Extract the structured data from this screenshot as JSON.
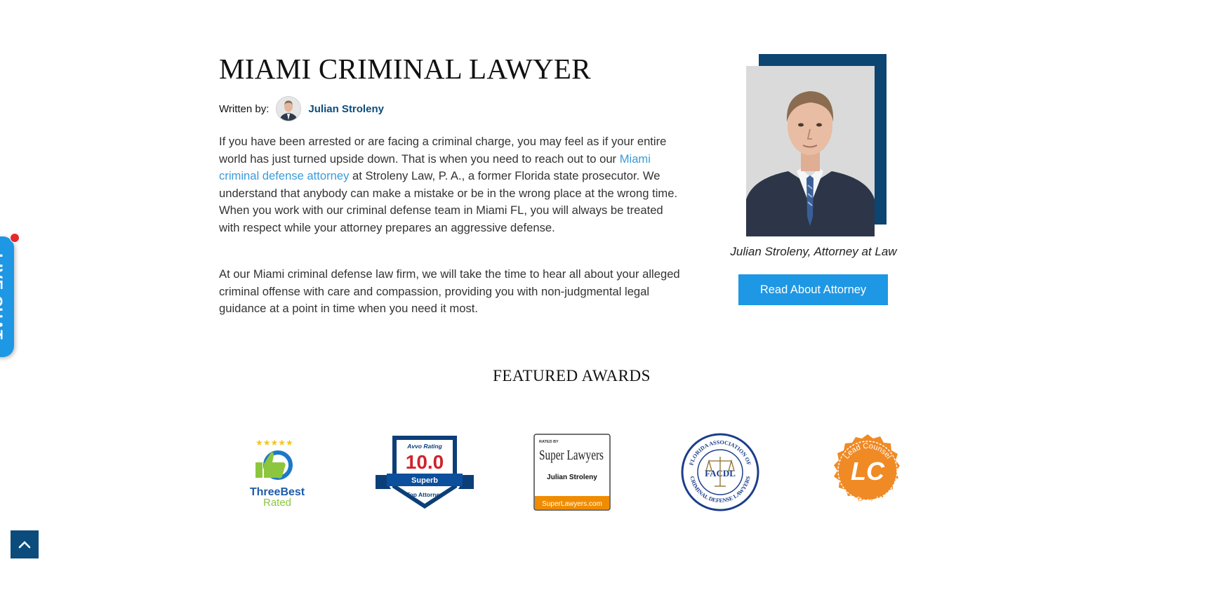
{
  "article": {
    "title": "MIAMI CRIMINAL LAWYER",
    "written_by_label": "Written by:",
    "author_name": "Julian Stroleny",
    "paragraph1_before_link": "If you have been arrested or are facing a criminal charge, you may feel as if your entire world has just turned upside down. That is when you need to reach out to our ",
    "paragraph1_link": "Miami criminal defense attorney",
    "paragraph1_after_link": " at Stroleny Law, P. A., a former Florida state prosecutor. We understand that anybody can make a mistake or be in the wrong place at the wrong time. When you work with our criminal defense team in Miami FL, you will always be treated with respect while your attorney prepares an aggressive defense.",
    "paragraph2": "At our Miami criminal defense law firm, we will take the time to hear all about your alleged criminal offense with care and compassion, providing you with non-judgmental legal guidance at a point in time when you need it most."
  },
  "attorney_card": {
    "caption": "Julian Stroleny, Attorney at Law",
    "button_label": "Read About Attorney"
  },
  "awards": {
    "title": "FEATURED AWARDS",
    "threebest": {
      "line1": "ThreeBest",
      "line2": "Rated"
    },
    "avvo": {
      "brand": "Avvo Rating",
      "score": "10.0",
      "ribbon": "Superb",
      "footer": "Top Attorney"
    },
    "superlawyers": {
      "rated_by": "RATED BY",
      "brand": "Super Lawyers",
      "name": "Julian Stroleny",
      "footer": "SuperLawyers.com"
    },
    "facdl": {
      "center": "FACDL",
      "top_arc": "FLORIDA ASSOCIATION OF",
      "bottom_arc": "CRIMINAL DEFENSE LAWYERS"
    },
    "leadcounsel": {
      "top_arc": "Lead Counsel",
      "center": "LC",
      "bottom_arc": "Rated"
    }
  },
  "widgets": {
    "live_chat_label": "LIVE CHAT",
    "scroll_top_icon": "chevron-up-icon"
  },
  "colors": {
    "navy": "#0c4c7c",
    "button_blue": "#1e97e4",
    "link_blue": "#3a9bd8",
    "avvo_red": "#d0232c",
    "superlawyers_orange": "#f08c00",
    "leadcounsel_orange": "#f08a24",
    "threebest_green": "#8cc63f"
  }
}
